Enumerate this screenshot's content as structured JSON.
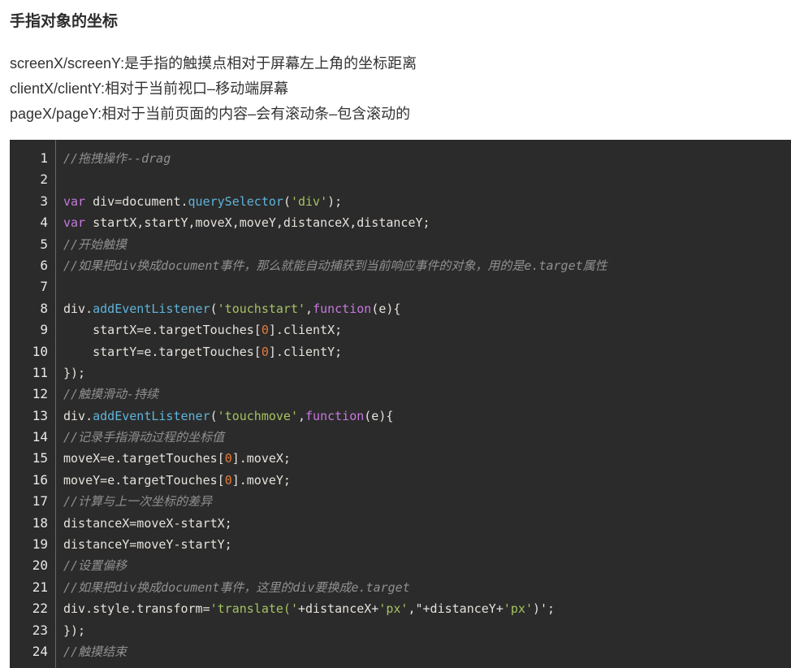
{
  "heading": "手指对象的坐标",
  "description": [
    "screenX/screenY:是手指的触摸点相对于屏幕左上角的坐标距离",
    "clientX/clientY:相对于当前视口–移动端屏幕",
    "pageX/pageY:相对于当前页面的内容–会有滚动条–包含滚动的"
  ],
  "code": {
    "line_numbers": [
      "1",
      "2",
      "3",
      "4",
      "5",
      "6",
      "7",
      "8",
      "9",
      "10",
      "11",
      "12",
      "13",
      "14",
      "15",
      "16",
      "17",
      "18",
      "19",
      "20",
      "21",
      "22",
      "23",
      "24"
    ],
    "lines": [
      [
        {
          "t": "comment",
          "v": "//拖拽操作--drag"
        }
      ],
      [],
      [
        {
          "t": "kw",
          "v": "var"
        },
        {
          "t": "plain",
          "v": " div=document."
        },
        {
          "t": "fn",
          "v": "querySelector"
        },
        {
          "t": "plain",
          "v": "("
        },
        {
          "t": "str",
          "v": "'div'"
        },
        {
          "t": "plain",
          "v": ");"
        }
      ],
      [
        {
          "t": "kw",
          "v": "var"
        },
        {
          "t": "plain",
          "v": " startX,startY,moveX,moveY,distanceX,distanceY;"
        }
      ],
      [
        {
          "t": "comment",
          "v": "//开始触摸"
        }
      ],
      [
        {
          "t": "comment",
          "v": "//如果把div换成document事件，那么就能自动捕获到当前响应事件的对象，用的是e.target属性"
        }
      ],
      [],
      [
        {
          "t": "plain",
          "v": "div."
        },
        {
          "t": "fn",
          "v": "addEventListener"
        },
        {
          "t": "plain",
          "v": "("
        },
        {
          "t": "str",
          "v": "'touchstart'"
        },
        {
          "t": "plain",
          "v": ","
        },
        {
          "t": "kw",
          "v": "function"
        },
        {
          "t": "plain",
          "v": "(e){"
        }
      ],
      [
        {
          "t": "plain",
          "v": "    startX=e.targetTouches["
        },
        {
          "t": "num",
          "v": "0"
        },
        {
          "t": "plain",
          "v": "].clientX;"
        }
      ],
      [
        {
          "t": "plain",
          "v": "    startY=e.targetTouches["
        },
        {
          "t": "num",
          "v": "0"
        },
        {
          "t": "plain",
          "v": "].clientY;"
        }
      ],
      [
        {
          "t": "plain",
          "v": "});"
        }
      ],
      [
        {
          "t": "comment",
          "v": "//触摸滑动-持续"
        }
      ],
      [
        {
          "t": "plain",
          "v": "div."
        },
        {
          "t": "fn",
          "v": "addEventListener"
        },
        {
          "t": "plain",
          "v": "("
        },
        {
          "t": "str",
          "v": "'touchmove'"
        },
        {
          "t": "plain",
          "v": ","
        },
        {
          "t": "kw",
          "v": "function"
        },
        {
          "t": "plain",
          "v": "(e){"
        }
      ],
      [
        {
          "t": "comment",
          "v": "//记录手指滑动过程的坐标值"
        }
      ],
      [
        {
          "t": "plain",
          "v": "moveX=e.targetTouches["
        },
        {
          "t": "num",
          "v": "0"
        },
        {
          "t": "plain",
          "v": "].moveX;"
        }
      ],
      [
        {
          "t": "plain",
          "v": "moveY=e.targetTouches["
        },
        {
          "t": "num",
          "v": "0"
        },
        {
          "t": "plain",
          "v": "].moveY;"
        }
      ],
      [
        {
          "t": "comment",
          "v": "//计算与上一次坐标的差异"
        }
      ],
      [
        {
          "t": "plain",
          "v": "distanceX=moveX-startX;"
        }
      ],
      [
        {
          "t": "plain",
          "v": "distanceY=moveY-startY;"
        }
      ],
      [
        {
          "t": "comment",
          "v": "//设置偏移"
        }
      ],
      [
        {
          "t": "comment",
          "v": "//如果把div换成document事件，这里的div要换成e.target"
        }
      ],
      [
        {
          "t": "plain",
          "v": "div.style.transform="
        },
        {
          "t": "str",
          "v": "'translate('"
        },
        {
          "t": "plain",
          "v": "+distanceX+"
        },
        {
          "t": "str",
          "v": "'px'"
        },
        {
          "t": "plain",
          "v": ",\"+distanceY+"
        },
        {
          "t": "str",
          "v": "'px'"
        },
        {
          "t": "plain",
          "v": ")';"
        }
      ],
      [
        {
          "t": "plain",
          "v": "});"
        }
      ],
      [
        {
          "t": "comment",
          "v": "//触摸结束"
        }
      ]
    ]
  },
  "colors": {
    "code_background": "#2b2b2b",
    "keyword": "#c678dd",
    "function": "#5fb3d9",
    "string": "#a5c261",
    "number": "#e57a3a",
    "comment": "#909090",
    "plain": "#e6e1dc"
  }
}
